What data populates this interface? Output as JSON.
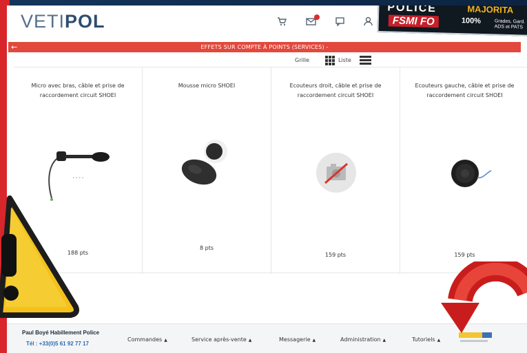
{
  "header": {
    "logo_light": "VETI",
    "logo_bold": "POL",
    "icons": [
      "cart-icon",
      "mail-icon",
      "chat-icon",
      "user-icon"
    ]
  },
  "badge": {
    "line1": "POLICE",
    "line2": "MAJORITA",
    "line3": "FSMI FO",
    "line4": "100%",
    "line5": "Grades, Gard. ADS et PATS"
  },
  "titlebar": {
    "back_icon": "arrow-left-icon",
    "title": "EFFETS SUR COMPTE À POINTS (SERVICES) -"
  },
  "views": {
    "grid_label": "Grille",
    "list_label": "Liste"
  },
  "products": [
    {
      "name": "Micro avec bras, câble et prise de raccordement circuit SHOEI",
      "points": "188 pts",
      "image": "microphone-headset"
    },
    {
      "name": "Mousse micro SHOEI",
      "points": "8 pts",
      "image": "foam-covers"
    },
    {
      "name": "Ecouteurs droit, câble et prise de raccordement circuit SHOEI",
      "points": "159 pts",
      "image": "no-image-placeholder"
    },
    {
      "name": "Ecouteurs gauche, câble et prise de raccordement circuit SHOEI",
      "points": "159 pts",
      "image": "earphone"
    }
  ],
  "footer": {
    "company": "Paul Boyé Habillement Police",
    "tel": "Tél : +33(0)5 61 92 77 17",
    "menu": [
      "Commandes",
      "Service après-vente",
      "Messagerie",
      "Administration",
      "Tutoriels"
    ]
  },
  "colors": {
    "accent_red": "#e2483c",
    "logo_blue": "#2e4d6e",
    "phone_blue": "#2a6db0",
    "warning_yellow": "#f4c11c"
  }
}
